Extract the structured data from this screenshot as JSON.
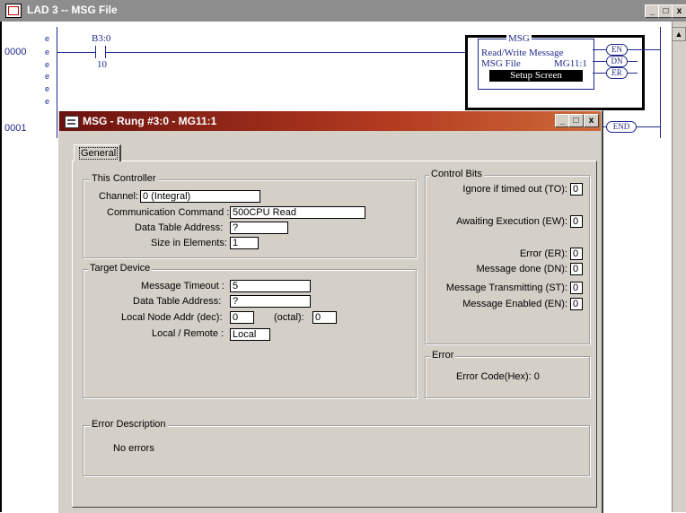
{
  "lad_window": {
    "title": "LAD 3 -- MSG File",
    "controls": [
      "_",
      "□",
      "x"
    ]
  },
  "ladder": {
    "rung0_number": "0000",
    "rung1_number": "0001",
    "rung_markers": [
      "e",
      "e",
      "e",
      "e",
      "e",
      "e"
    ],
    "contact_address": "B3:0",
    "contact_bit": "10",
    "msg_block_title": "MSG",
    "msg_block_desc": "Read/Write Message",
    "msg_file_label": "MSG File",
    "msg_file_value": "MG11:1",
    "setup_screen": "Setup Screen",
    "coils": [
      "EN",
      "DN",
      "ER"
    ],
    "end_label": "END"
  },
  "dialog": {
    "title": "MSG - Rung #3:0 - MG11:1",
    "tab_label": "General",
    "this_controller": {
      "group_title": "This Controller",
      "channel_label": "Channel:",
      "channel_value": "0 (Integral)",
      "command_label": "Communication Command :",
      "command_value": "500CPU Read",
      "data_table_label": "Data Table Address:",
      "data_table_value": "?",
      "size_label": "Size in Elements:",
      "size_value": "1"
    },
    "target_device": {
      "group_title": "Target Device",
      "timeout_label": "Message Timeout :",
      "timeout_value": "5",
      "data_table_label": "Data Table Address:",
      "data_table_value": "?",
      "node_label": "Local Node Addr (dec):",
      "node_value": "0",
      "octal_label": "(octal):",
      "octal_value": "0",
      "local_remote_label": "Local / Remote :",
      "local_remote_value": "Local"
    },
    "control_bits": {
      "group_title": "Control Bits",
      "bits": [
        {
          "label": "Ignore if timed out (TO):",
          "value": "0"
        },
        {
          "label": "Awaiting Execution (EW):",
          "value": "0"
        },
        {
          "label": "Error (ER):",
          "value": "0"
        },
        {
          "label": "Message done (DN):",
          "value": "0"
        },
        {
          "label": "Message Transmitting (ST):",
          "value": "0"
        },
        {
          "label": "Message Enabled (EN):",
          "value": "0"
        }
      ]
    },
    "error": {
      "group_title": "Error",
      "code_label": "Error Code(Hex): 0"
    },
    "error_description": {
      "group_title": "Error Description",
      "text": "No errors"
    }
  }
}
